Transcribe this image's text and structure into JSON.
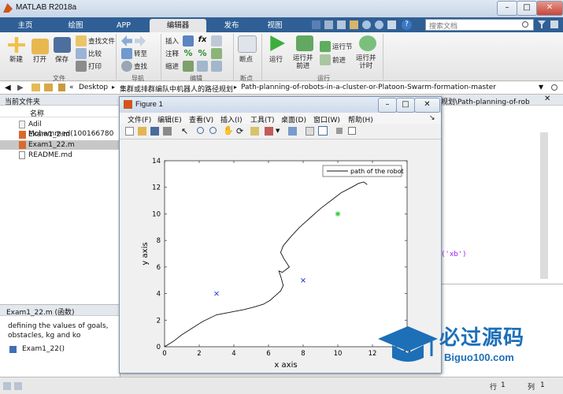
{
  "window": {
    "title": "MATLAB R2018a"
  },
  "tabs": [
    "主页",
    "绘图",
    "APP",
    "编辑器",
    "发布",
    "视图"
  ],
  "search": {
    "placeholder": "搜索文档"
  },
  "ribbon": {
    "file_group": [
      "新建",
      "打开",
      "保存"
    ],
    "file_small": [
      "查找文件",
      "比较",
      "打印"
    ],
    "nav_group": [
      "转至",
      "查找"
    ],
    "edit_group": [
      "插入",
      "注释",
      "缩进"
    ],
    "breakpoint": "断点",
    "run": "运行",
    "run_advance": "运行并\n前进",
    "run_section": "运行节",
    "advance": "前进",
    "run_time": "运行并\n计时",
    "group_labels": [
      "文件",
      "导航",
      "编辑",
      "断点",
      "运行"
    ]
  },
  "address": {
    "parts": [
      "Desktop",
      "集群或排群编队中机器人的路径规划",
      "Path-planning-of-robots-in-a-cluster-or-Platoon-Swarm-formation-master"
    ]
  },
  "current_folder": {
    "title": "当前文件夹",
    "column": "名称",
    "files": [
      "Adil Mohammed(100166780",
      "Exam1_2.m",
      "Exam1_22.m",
      "README.md"
    ]
  },
  "details": {
    "title": "Exam1_22.m (函数)",
    "description": "defining the values of goals, obstacles, kg and ko",
    "function": "Exam1_22()"
  },
  "editor_fragments": {
    "path_tail": "规划\\Path-planning-of-rob",
    "code": "('xb')"
  },
  "statusbar": {
    "row_label": "行",
    "row": "1",
    "col_label": "列",
    "col": "1"
  },
  "figure": {
    "title": "Figure 1",
    "menu": [
      "文件(F)",
      "编辑(E)",
      "查看(V)",
      "插入(I)",
      "工具(T)",
      "桌面(D)",
      "窗口(W)",
      "帮助(H)"
    ]
  },
  "chart_data": {
    "type": "line",
    "title": "",
    "xlabel": "x axis",
    "ylabel": "y axis",
    "xlim": [
      0,
      14
    ],
    "ylim": [
      0,
      14
    ],
    "xticks": [
      0,
      2,
      4,
      6,
      8,
      10,
      12,
      14
    ],
    "yticks": [
      0,
      2,
      4,
      6,
      8,
      10,
      12,
      14
    ],
    "legend": {
      "position": "top-right",
      "entries": [
        "path of the robot"
      ]
    },
    "series": [
      {
        "name": "path of the robot",
        "color": "#111111",
        "x": [
          0,
          0.5,
          1,
          1.6,
          2.2,
          3,
          3.8,
          4.6,
          5.2,
          5.7,
          6.1,
          6.4,
          6.7,
          6.85,
          6.75,
          6.6,
          6.8,
          7.2,
          6.9,
          6.7,
          6.85,
          7.3,
          7.8,
          8.4,
          9.0,
          9.6,
          10.2,
          10.8,
          11.2,
          11.5,
          11.7
        ],
        "y": [
          0,
          0.4,
          0.9,
          1.4,
          1.9,
          2.4,
          2.6,
          2.8,
          3.0,
          3.2,
          3.5,
          3.85,
          4.2,
          4.6,
          5.1,
          5.7,
          5.6,
          6.0,
          6.6,
          7.1,
          7.6,
          8.3,
          9.0,
          9.7,
          10.4,
          11.0,
          11.6,
          12.0,
          12.3,
          12.4,
          12.2
        ]
      }
    ],
    "markers": [
      {
        "x": 3,
        "y": 4,
        "color": "#2b3fd0",
        "symbol": "x"
      },
      {
        "x": 8,
        "y": 5,
        "color": "#2b3fd0",
        "symbol": "x"
      },
      {
        "x": 10,
        "y": 10,
        "color": "#22cc33",
        "symbol": "*"
      }
    ]
  },
  "watermark": {
    "brand": "必过源码",
    "url": "Biguo100.com"
  }
}
